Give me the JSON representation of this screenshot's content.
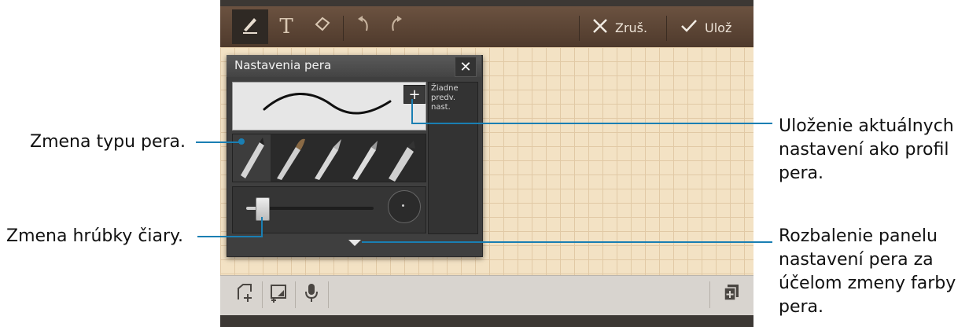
{
  "toolbar": {
    "cancel_label": "Zruš.",
    "save_label": "Ulož"
  },
  "panel": {
    "title": "Nastavenia pera",
    "presets_empty": "Žiadne predv. nast."
  },
  "callouts": {
    "pen_type": "Zmena typu pera.",
    "line_thickness": "Zmena hrúbky čiary.",
    "save_profile": "Uloženie aktuálnych nastavení ako profil pera.",
    "expand_panel": "Rozbalenie panelu nastavení pera za účelom zmeny farby pera."
  },
  "icons": {
    "pen": "pen-icon",
    "text": "text-icon",
    "eraser": "eraser-icon",
    "undo": "undo-icon",
    "redo": "redo-icon",
    "cancel": "close-icon",
    "save": "checkmark-icon",
    "insert_page": "insert-page-icon",
    "insert_image": "insert-image-icon",
    "voice": "microphone-icon",
    "add_page": "add-page-icon"
  },
  "colors": {
    "callout_line": "#1a7fb3",
    "paper": "#f3e2c4",
    "toolbar": "#5c4433"
  }
}
